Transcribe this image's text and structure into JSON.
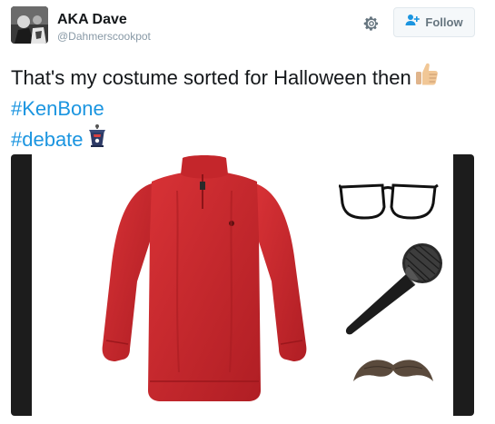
{
  "tweet": {
    "author_name": "AKA Dave",
    "author_handle": "@Dahmerscookpot",
    "text_line1": "That's my costume sorted for Halloween then",
    "hashtag1": "#KenBone",
    "hashtag2": "#debate"
  },
  "actions": {
    "follow_label": "Follow",
    "settings_icon": "gear-icon",
    "follow_icon": "add-user-icon"
  },
  "media": {
    "items": [
      "red-sweater",
      "black-glasses",
      "microphone",
      "mustache"
    ]
  },
  "colors": {
    "hashtag": "#1b95e0",
    "sweater": "#c8262b",
    "follow_bg": "#f5f8fa"
  }
}
